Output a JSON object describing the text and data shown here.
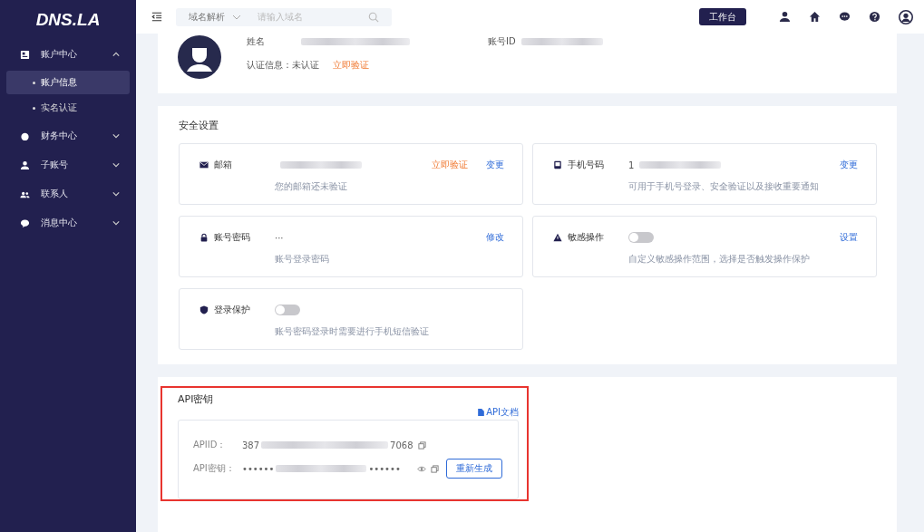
{
  "sidebar": {
    "logo": "DNS.LA",
    "items": [
      {
        "label": "账户中心",
        "expanded": true,
        "children": [
          {
            "label": "账户信息",
            "selected": true
          },
          {
            "label": "实名认证",
            "selected": false
          }
        ]
      },
      {
        "label": "财务中心",
        "expanded": false
      },
      {
        "label": "子账号",
        "expanded": false
      },
      {
        "label": "联系人",
        "expanded": false
      },
      {
        "label": "消息中心",
        "expanded": false
      }
    ]
  },
  "topbar": {
    "search_scope": "域名解析",
    "search": {
      "placeholder": "请输入域名"
    },
    "workbench_button": "工作台"
  },
  "profile": {
    "name_label": "姓名",
    "account_id_label": "账号ID",
    "auth_label": "认证信息：",
    "auth_status": "未认证",
    "auth_action": "立即验证"
  },
  "security": {
    "title": "安全设置",
    "items": [
      {
        "kind": "value",
        "label": "邮箱",
        "hint": "您的邮箱还未验证",
        "warn_action": "立即验证",
        "action": "变更"
      },
      {
        "kind": "value",
        "label": "手机号码",
        "value": "1",
        "hint": "可用于手机号登录、安全验证以及接收重要通知",
        "action": "变更"
      },
      {
        "kind": "value",
        "label": "账号密码",
        "value": "···",
        "hint": "账号登录密码",
        "action": "修改"
      },
      {
        "kind": "toggle",
        "label": "敏感操作",
        "on": false,
        "hint": "自定义敏感操作范围，选择是否触发操作保护",
        "action": "设置"
      },
      {
        "kind": "toggle",
        "label": "登录保护",
        "on": false,
        "hint": "账号密码登录时需要进行手机短信验证"
      }
    ]
  },
  "api": {
    "title": "API密钥",
    "doc_link": "API文档",
    "id_label": "APIID：",
    "id_start": "387",
    "id_end": "7068",
    "key_label": "API密钥：",
    "key_start": "••••••",
    "key_end": "••••••",
    "regenerate_button": "重新生成"
  }
}
